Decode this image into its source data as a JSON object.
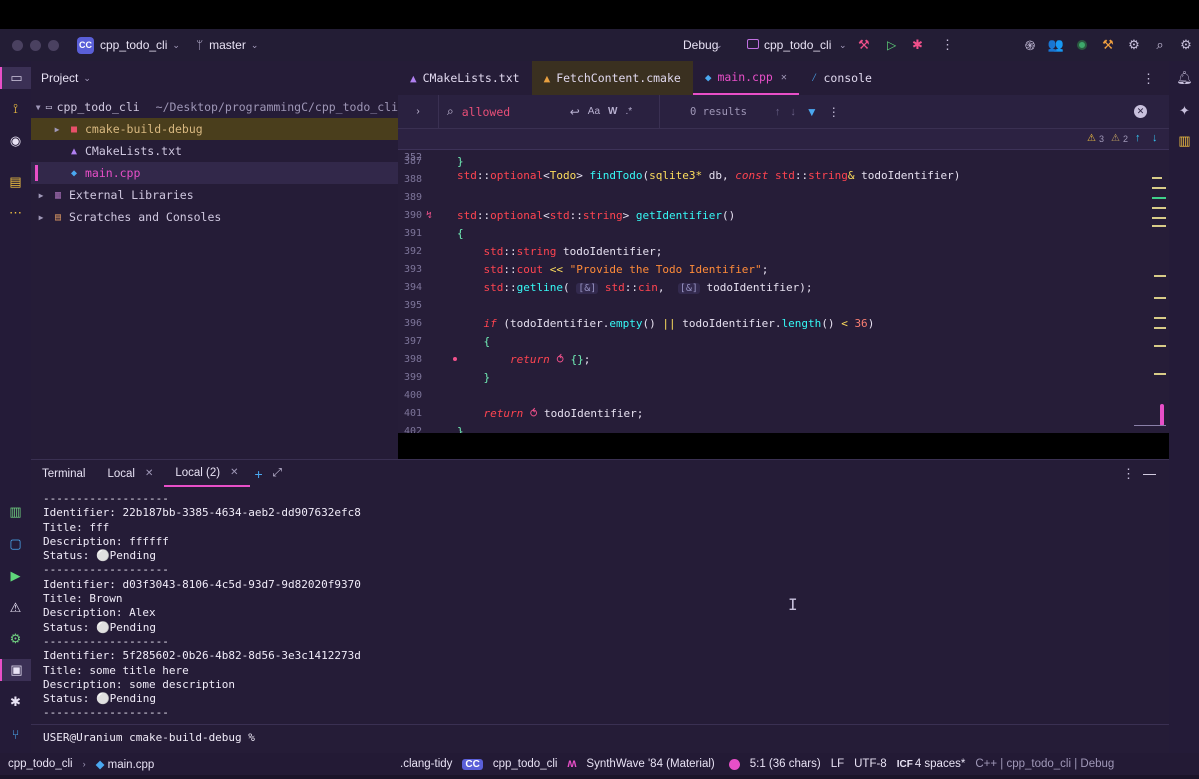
{
  "titlebar": {
    "project_badge": "CC",
    "project_name": "cpp_todo_cli",
    "branch": "master",
    "run_config": "Debug",
    "target": "cpp_todo_cli"
  },
  "project_panel": {
    "title": "Project",
    "root_name": "cpp_todo_cli",
    "root_path": "~/Desktop/programmingC/cpp_todo_cli",
    "items": [
      {
        "label": "cmake-build-debug"
      },
      {
        "label": "CMakeLists.txt"
      },
      {
        "label": "main.cpp"
      },
      {
        "label": "External Libraries"
      },
      {
        "label": "Scratches and Consoles"
      }
    ]
  },
  "editor_tabs": [
    {
      "label": "CMakeLists.txt"
    },
    {
      "label": "FetchContent.cmake"
    },
    {
      "label": "main.cpp"
    },
    {
      "label": "console"
    }
  ],
  "find_bar": {
    "query": "allowed",
    "case_label": "Aa",
    "word_label": "W",
    "regex_label": ".*",
    "results": "0 results"
  },
  "editor": {
    "sticky_line_no": "352",
    "warnings": "3",
    "weak_warnings": "2",
    "line_numbers": [
      "387",
      "388",
      "389",
      "390",
      "391",
      "392",
      "393",
      "394",
      "395",
      "396",
      "397",
      "398",
      "399",
      "400",
      "401",
      "402"
    ]
  },
  "terminal": {
    "tabs": [
      {
        "label": "Terminal"
      },
      {
        "label": "Local"
      },
      {
        "label": "Local (2)"
      }
    ],
    "lines": [
      "-------------------",
      "Identifier: 22b187bb-3385-4634-aeb2-dd907632efc8",
      "Title: fff",
      "Description: ffffff",
      "Status: ⚪Pending",
      "-------------------",
      "Identifier: d03f3043-8106-4c5d-93d7-9d82020f9370",
      "Title: Brown",
      "Description: Alex",
      "Status: ⚪Pending",
      "-------------------",
      "Identifier: 5f285602-0b26-4b82-8d56-3e3c1412273d",
      "Title: some title here",
      "Description: some description",
      "Status: ⚪Pending",
      "-------------------"
    ],
    "prompt": "USER@Uranium cmake-build-debug %"
  },
  "statusbar": {
    "crumb_project": "cpp_todo_cli",
    "crumb_file": "main.cpp",
    "clang_tidy": ".clang-tidy",
    "cc_badge": "CC",
    "project": "cpp_todo_cli",
    "theme": "SynthWave '84 (Material)",
    "position": "5:1 (36 chars)",
    "line_ending": "LF",
    "encoding": "UTF-8",
    "indent": "4 spaces*",
    "context": "C++ | cpp_todo_cli | Debug"
  },
  "colors": {
    "accent": "#e84fc8",
    "background": "#251c37",
    "string": "#ff8b39",
    "keyword": "#fe4450",
    "function": "#36f9f6",
    "type": "#fede5d"
  }
}
